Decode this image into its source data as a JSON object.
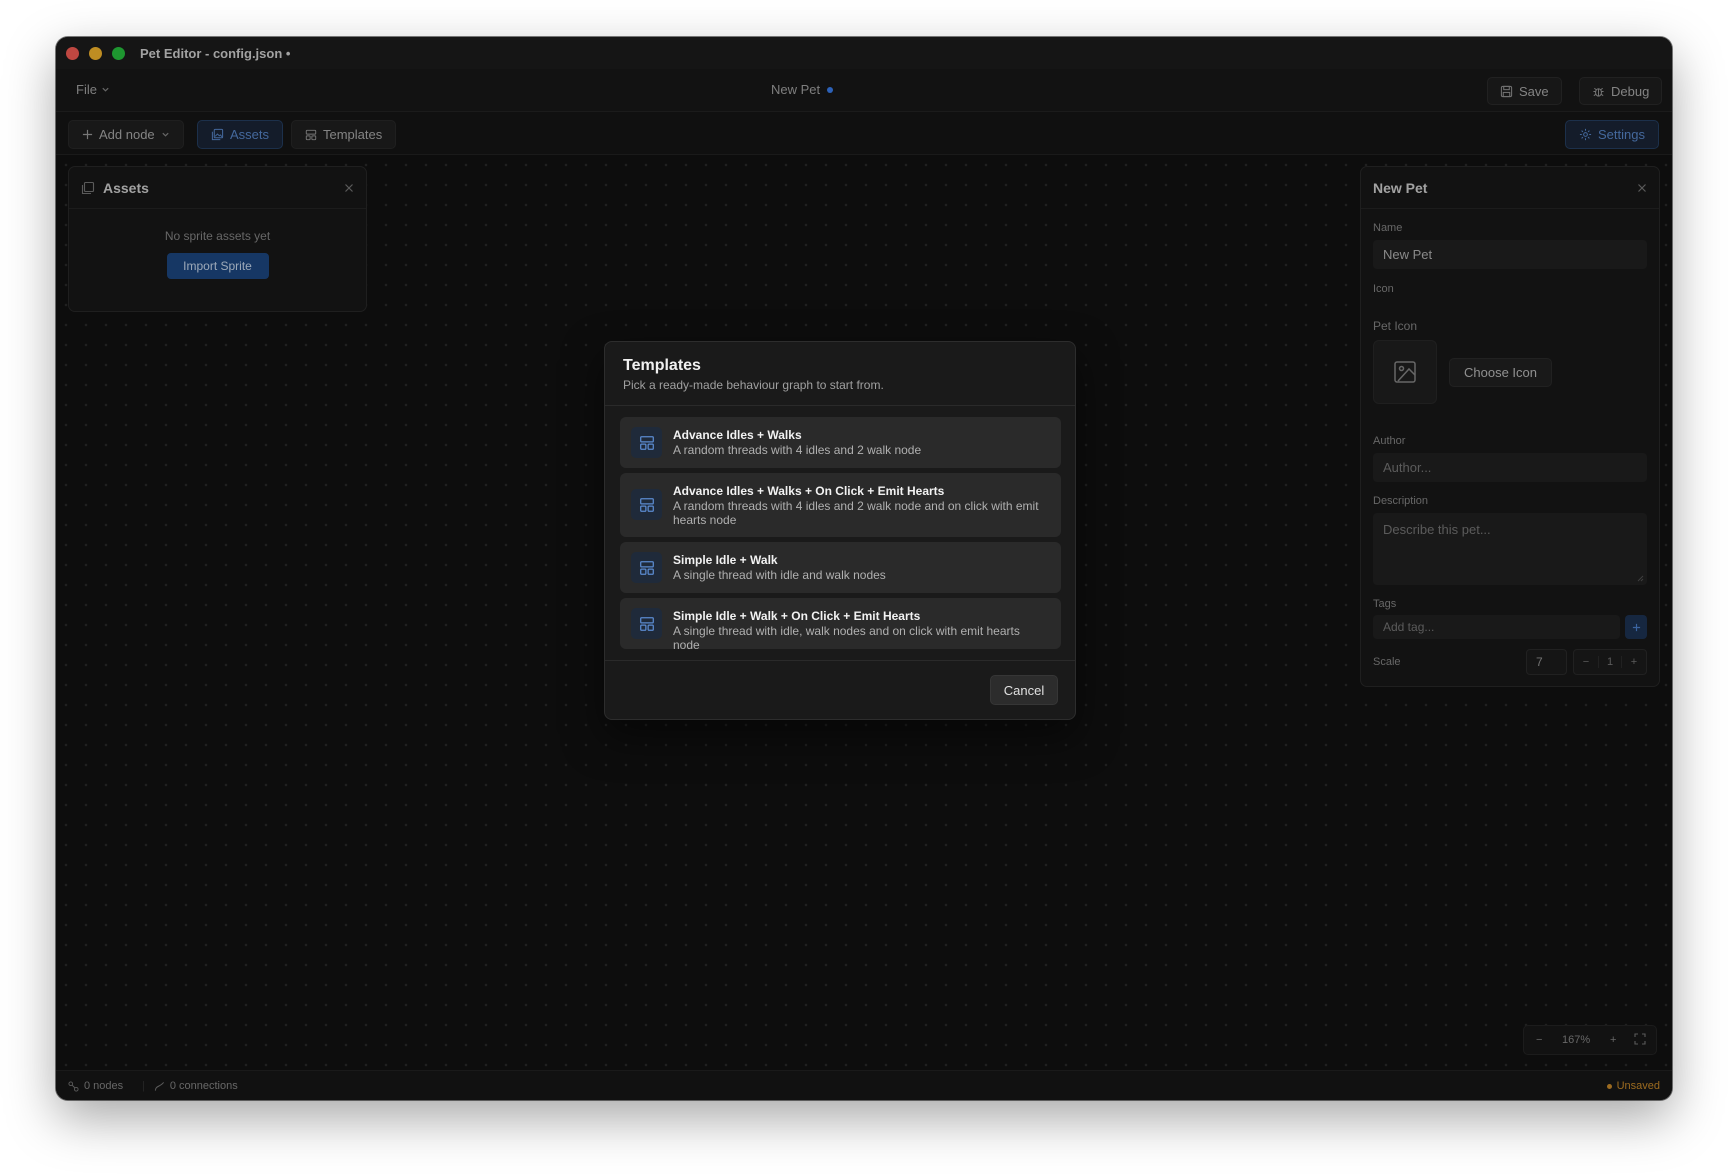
{
  "window": {
    "title": "Pet Editor - config.json •"
  },
  "menubar": {
    "file": "File",
    "doc_title": "New Pet",
    "save": "Save",
    "debug": "Debug"
  },
  "toolbar": {
    "add_node": "Add node",
    "assets": "Assets",
    "templates": "Templates",
    "settings": "Settings"
  },
  "assets_panel": {
    "title": "Assets",
    "empty": "No sprite assets yet",
    "import": "Import Sprite"
  },
  "props_panel": {
    "title": "New Pet",
    "name_label": "Name",
    "name_value": "New Pet",
    "icon_label": "Icon",
    "pet_icon_label": "Pet Icon",
    "choose_icon": "Choose Icon",
    "author_label": "Author",
    "author_placeholder": "Author...",
    "description_label": "Description",
    "description_placeholder": "Describe this pet...",
    "tags_label": "Tags",
    "tags_placeholder": "Add tag...",
    "scale_label": "Scale",
    "scale_value": "7",
    "scale_step": "1"
  },
  "modal": {
    "title": "Templates",
    "subtitle": "Pick a ready-made behaviour graph to start from.",
    "templates": [
      {
        "name": "Advance Idles + Walks",
        "desc": "A random threads with 4 idles and 2 walk node"
      },
      {
        "name": "Advance Idles + Walks + On Click + Emit Hearts",
        "desc": "A random threads with 4 idles and 2 walk node and on click with emit hearts node"
      },
      {
        "name": "Simple Idle + Walk",
        "desc": "A single thread with idle and walk nodes"
      },
      {
        "name": "Simple Idle + Walk + On Click + Emit Hearts",
        "desc": "A single thread with idle, walk nodes and on click with emit hearts node"
      }
    ],
    "cancel": "Cancel"
  },
  "zoom": {
    "level": "167%"
  },
  "status": {
    "nodes": "0 nodes",
    "connections": "0 connections",
    "unsaved": "Unsaved"
  },
  "colors": {
    "accent": "#3b82f6",
    "unsaved": "#d18f2b",
    "import_button": "#1e4a86"
  }
}
